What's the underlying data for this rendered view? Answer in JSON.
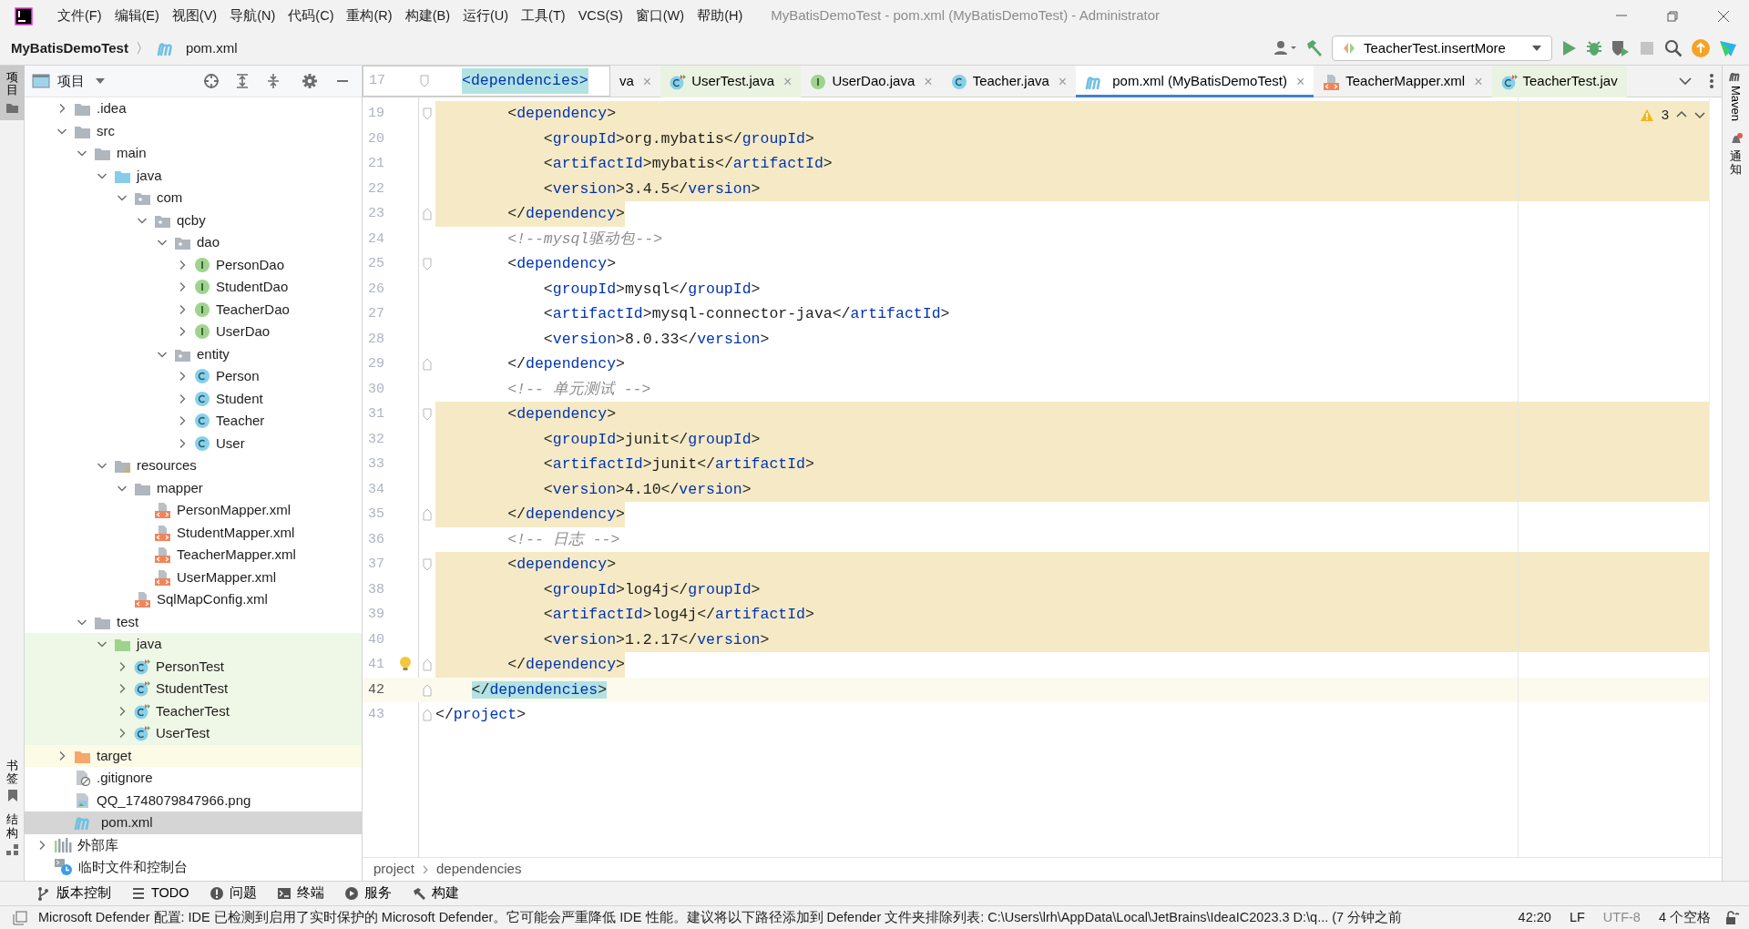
{
  "window": {
    "title": "MyBatisDemoTest - pom.xml (MyBatisDemoTest) - Administrator"
  },
  "menu": [
    "文件(F)",
    "编辑(E)",
    "视图(V)",
    "导航(N)",
    "代码(C)",
    "重构(R)",
    "构建(B)",
    "运行(U)",
    "工具(T)",
    "VCS(S)",
    "窗口(W)",
    "帮助(H)"
  ],
  "breadcrumb": {
    "project": "MyBatisDemoTest",
    "separator": "〉",
    "file": "pom.xml"
  },
  "run_config": {
    "label": "TeacherTest.insertMore"
  },
  "left_stripe": [
    {
      "label": "项目",
      "selected": true
    },
    {
      "label": "书签",
      "selected": false
    },
    {
      "label": "结构",
      "selected": false
    }
  ],
  "right_stripe": [
    {
      "kind": "maven",
      "label": "Maven"
    },
    {
      "kind": "notifications",
      "label": "通知"
    }
  ],
  "project_panel": {
    "title": "项目"
  },
  "tree": {
    "module_items": [
      {
        "label": ".idea",
        "kind": "folder",
        "expanded": false
      },
      {
        "label": "src",
        "kind": "folder",
        "expanded": true,
        "children": [
          {
            "label": "main",
            "kind": "folder",
            "expanded": true,
            "children": [
              {
                "label": "java",
                "kind": "source",
                "expanded": true,
                "children": [
                  {
                    "label": "com",
                    "kind": "package",
                    "expanded": true,
                    "children": [
                      {
                        "label": "qcby",
                        "kind": "package",
                        "expanded": true,
                        "children": [
                          {
                            "label": "dao",
                            "kind": "package",
                            "expanded": true,
                            "children": [
                              {
                                "label": "PersonDao",
                                "kind": "interface",
                                "expanded": false
                              },
                              {
                                "label": "StudentDao",
                                "kind": "interface",
                                "expanded": false
                              },
                              {
                                "label": "TeacherDao",
                                "kind": "interface",
                                "expanded": false
                              },
                              {
                                "label": "UserDao",
                                "kind": "interface",
                                "expanded": false
                              }
                            ]
                          },
                          {
                            "label": "entity",
                            "kind": "package",
                            "expanded": true,
                            "children": [
                              {
                                "label": "Person",
                                "kind": "class",
                                "expanded": false
                              },
                              {
                                "label": "Student",
                                "kind": "class",
                                "expanded": false
                              },
                              {
                                "label": "Teacher",
                                "kind": "class",
                                "expanded": false
                              },
                              {
                                "label": "User",
                                "kind": "class",
                                "expanded": false
                              }
                            ]
                          }
                        ]
                      }
                    ]
                  }
                ]
              },
              {
                "label": "resources",
                "kind": "resources",
                "expanded": true,
                "children": [
                  {
                    "label": "mapper",
                    "kind": "folder",
                    "expanded": true,
                    "children": [
                      {
                        "label": "PersonMapper.xml",
                        "kind": "xml"
                      },
                      {
                        "label": "StudentMapper.xml",
                        "kind": "xml"
                      },
                      {
                        "label": "TeacherMapper.xml",
                        "kind": "xml"
                      },
                      {
                        "label": "UserMapper.xml",
                        "kind": "xml"
                      }
                    ]
                  },
                  {
                    "label": "SqlMapConfig.xml",
                    "kind": "xml"
                  }
                ]
              }
            ]
          },
          {
            "label": "test",
            "kind": "folder",
            "expanded": true,
            "children": [
              {
                "label": "java",
                "kind": "test-source",
                "expanded": true,
                "children": [
                  {
                    "label": "PersonTest",
                    "kind": "test-class",
                    "expanded": false
                  },
                  {
                    "label": "StudentTest",
                    "kind": "test-class",
                    "expanded": false
                  },
                  {
                    "label": "TeacherTest",
                    "kind": "test-class",
                    "expanded": false
                  },
                  {
                    "label": "UserTest",
                    "kind": "test-class",
                    "expanded": false
                  }
                ]
              }
            ]
          }
        ]
      },
      {
        "label": "target",
        "kind": "excluded",
        "expanded": false
      },
      {
        "label": ".gitignore",
        "kind": "ignore"
      },
      {
        "label": "QQ_1748079847966.png",
        "kind": "image"
      },
      {
        "label": "pom.xml",
        "kind": "maven",
        "selected": true
      }
    ],
    "top_items": [
      {
        "label": "外部库",
        "kind": "library",
        "expanded": false
      },
      {
        "label": "临时文件和控制台",
        "kind": "scratch"
      }
    ]
  },
  "sticky": {
    "number": "17",
    "text": "<dependencies>"
  },
  "tabs": [
    {
      "label": "va",
      "kind": "none",
      "selected": false,
      "close": "×"
    },
    {
      "label": "UserTest.java",
      "kind": "test-class",
      "selected": false,
      "close": "×"
    },
    {
      "label": "UserDao.java",
      "kind": "interface",
      "selected": false,
      "close": "×"
    },
    {
      "label": "Teacher.java",
      "kind": "class",
      "selected": false,
      "close": "×"
    },
    {
      "label": "pom.xml (MyBatisDemoTest)",
      "kind": "maven",
      "selected": true,
      "close": "×"
    },
    {
      "label": "TeacherMapper.xml",
      "kind": "xml",
      "selected": false,
      "close": "×"
    },
    {
      "label": "TeacherTest.jav",
      "kind": "test-class",
      "selected": false
    }
  ],
  "warnings": {
    "count": "3"
  },
  "code": [
    {
      "num": "19",
      "kind": "highlighted",
      "fold_start": true,
      "parts": [
        {
          "kind": "plain",
          "text": "        <"
        },
        {
          "kind": "tag",
          "text": "dependency"
        },
        {
          "kind": "plain",
          "text": ">"
        }
      ]
    },
    {
      "num": "20",
      "kind": "highlighted",
      "parts": [
        {
          "kind": "plain",
          "text": "            <"
        },
        {
          "kind": "tag",
          "text": "groupId"
        },
        {
          "kind": "plain",
          "text": ">org.mybatis</"
        },
        {
          "kind": "tag",
          "text": "groupId"
        },
        {
          "kind": "plain",
          "text": ">"
        }
      ]
    },
    {
      "num": "21",
      "kind": "highlighted",
      "parts": [
        {
          "kind": "plain",
          "text": "            <"
        },
        {
          "kind": "tag",
          "text": "artifactId"
        },
        {
          "kind": "plain",
          "text": ">mybatis</"
        },
        {
          "kind": "tag",
          "text": "artifactId"
        },
        {
          "kind": "plain",
          "text": ">"
        }
      ]
    },
    {
      "num": "22",
      "kind": "highlighted",
      "parts": [
        {
          "kind": "plain",
          "text": "            <"
        },
        {
          "kind": "tag",
          "text": "version"
        },
        {
          "kind": "plain",
          "text": ">3.4.5</"
        },
        {
          "kind": "tag",
          "text": "version"
        },
        {
          "kind": "plain",
          "text": ">"
        }
      ]
    },
    {
      "num": "23",
      "kind": "highlighted-end",
      "fold_end": true,
      "parts": [
        {
          "kind": "plain",
          "text": "        </"
        },
        {
          "kind": "tag",
          "text": "dependency"
        },
        {
          "kind": "plain",
          "text": ">"
        }
      ]
    },
    {
      "num": "24",
      "kind": "normal",
      "parts": [
        {
          "kind": "comment",
          "text": "        <!--mysql驱动包-->"
        }
      ]
    },
    {
      "num": "25",
      "kind": "normal",
      "fold_start": true,
      "parts": [
        {
          "kind": "plain",
          "text": "        <"
        },
        {
          "kind": "tag",
          "text": "dependency"
        },
        {
          "kind": "plain",
          "text": ">"
        }
      ]
    },
    {
      "num": "26",
      "kind": "normal",
      "parts": [
        {
          "kind": "plain",
          "text": "            <"
        },
        {
          "kind": "tag",
          "text": "groupId"
        },
        {
          "kind": "plain",
          "text": ">mysql</"
        },
        {
          "kind": "tag",
          "text": "groupId"
        },
        {
          "kind": "plain",
          "text": ">"
        }
      ]
    },
    {
      "num": "27",
      "kind": "normal",
      "parts": [
        {
          "kind": "plain",
          "text": "            <"
        },
        {
          "kind": "tag",
          "text": "artifactId"
        },
        {
          "kind": "plain",
          "text": ">mysql-connector-java</"
        },
        {
          "kind": "tag",
          "text": "artifactId"
        },
        {
          "kind": "plain",
          "text": ">"
        }
      ]
    },
    {
      "num": "28",
      "kind": "normal",
      "parts": [
        {
          "kind": "plain",
          "text": "            <"
        },
        {
          "kind": "tag",
          "text": "version"
        },
        {
          "kind": "plain",
          "text": ">8.0.33</"
        },
        {
          "kind": "tag",
          "text": "version"
        },
        {
          "kind": "plain",
          "text": ">"
        }
      ]
    },
    {
      "num": "29",
      "kind": "normal",
      "fold_end": true,
      "parts": [
        {
          "kind": "plain",
          "text": "        </"
        },
        {
          "kind": "tag",
          "text": "dependency"
        },
        {
          "kind": "plain",
          "text": ">"
        }
      ]
    },
    {
      "num": "30",
      "kind": "normal",
      "parts": [
        {
          "kind": "comment",
          "text": "        <!-- 单元测试 -->"
        }
      ]
    },
    {
      "num": "31",
      "kind": "highlighted",
      "fold_start": true,
      "parts": [
        {
          "kind": "plain",
          "text": "        <"
        },
        {
          "kind": "tag",
          "text": "dependency"
        },
        {
          "kind": "plain",
          "text": ">"
        }
      ]
    },
    {
      "num": "32",
      "kind": "highlighted",
      "parts": [
        {
          "kind": "plain",
          "text": "            <"
        },
        {
          "kind": "tag",
          "text": "groupId"
        },
        {
          "kind": "plain",
          "text": ">junit</"
        },
        {
          "kind": "tag",
          "text": "groupId"
        },
        {
          "kind": "plain",
          "text": ">"
        }
      ]
    },
    {
      "num": "33",
      "kind": "highlighted",
      "parts": [
        {
          "kind": "plain",
          "text": "            <"
        },
        {
          "kind": "tag",
          "text": "artifactId"
        },
        {
          "kind": "plain",
          "text": ">junit</"
        },
        {
          "kind": "tag",
          "text": "artifactId"
        },
        {
          "kind": "plain",
          "text": ">"
        }
      ]
    },
    {
      "num": "34",
      "kind": "highlighted",
      "parts": [
        {
          "kind": "plain",
          "text": "            <"
        },
        {
          "kind": "tag",
          "text": "version"
        },
        {
          "kind": "plain",
          "text": ">4.10</"
        },
        {
          "kind": "tag",
          "text": "version"
        },
        {
          "kind": "plain",
          "text": ">"
        }
      ]
    },
    {
      "num": "35",
      "kind": "highlighted-end",
      "fold_end": true,
      "parts": [
        {
          "kind": "plain",
          "text": "        </"
        },
        {
          "kind": "tag",
          "text": "dependency"
        },
        {
          "kind": "plain",
          "text": ">"
        }
      ]
    },
    {
      "num": "36",
      "kind": "normal",
      "parts": [
        {
          "kind": "comment",
          "text": "        <!-- 日志 -->"
        }
      ]
    },
    {
      "num": "37",
      "kind": "highlighted",
      "fold_start": true,
      "parts": [
        {
          "kind": "plain",
          "text": "        <"
        },
        {
          "kind": "tag",
          "text": "dependency"
        },
        {
          "kind": "plain",
          "text": ">"
        }
      ]
    },
    {
      "num": "38",
      "kind": "highlighted",
      "parts": [
        {
          "kind": "plain",
          "text": "            <"
        },
        {
          "kind": "tag",
          "text": "groupId"
        },
        {
          "kind": "plain",
          "text": ">log4j</"
        },
        {
          "kind": "tag",
          "text": "groupId"
        },
        {
          "kind": "plain",
          "text": ">"
        }
      ]
    },
    {
      "num": "39",
      "kind": "highlighted",
      "parts": [
        {
          "kind": "plain",
          "text": "            <"
        },
        {
          "kind": "tag",
          "text": "artifactId"
        },
        {
          "kind": "plain",
          "text": ">log4j</"
        },
        {
          "kind": "tag",
          "text": "artifactId"
        },
        {
          "kind": "plain",
          "text": ">"
        }
      ]
    },
    {
      "num": "40",
      "kind": "highlighted",
      "parts": [
        {
          "kind": "plain",
          "text": "            <"
        },
        {
          "kind": "tag",
          "text": "version"
        },
        {
          "kind": "plain",
          "text": ">1.2.17</"
        },
        {
          "kind": "tag",
          "text": "version"
        },
        {
          "kind": "plain",
          "text": ">"
        }
      ]
    },
    {
      "num": "41",
      "kind": "highlighted-end",
      "fold_end": true,
      "bulb": true,
      "parts": [
        {
          "kind": "plain",
          "text": "        </"
        },
        {
          "kind": "tag",
          "text": "dependency"
        },
        {
          "kind": "plain",
          "text": ">"
        }
      ]
    },
    {
      "num": "42",
      "kind": "current",
      "fold_end": true,
      "parts": [
        {
          "kind": "match",
          "text": "    </"
        },
        {
          "kind": "match-tag",
          "text": "dependencies"
        },
        {
          "kind": "match",
          "text": ">"
        }
      ]
    },
    {
      "num": "43",
      "kind": "normal",
      "fold_end": true,
      "parts": [
        {
          "kind": "plain",
          "text": "</"
        },
        {
          "kind": "tag",
          "text": "project"
        },
        {
          "kind": "plain",
          "text": ">"
        }
      ]
    }
  ],
  "editor_breadcrumb": [
    "project",
    "dependencies"
  ],
  "tool_windows": [
    {
      "kind": "vcs",
      "label": "版本控制"
    },
    {
      "kind": "todo",
      "label": "TODO"
    },
    {
      "kind": "problems",
      "label": "问题"
    },
    {
      "kind": "terminal",
      "label": "终端"
    },
    {
      "kind": "services",
      "label": "服务"
    },
    {
      "kind": "build",
      "label": "构建"
    }
  ],
  "status_bar": {
    "message": "Microsoft Defender 配置: IDE 已检测到启用了实时保护的 Microsoft Defender。它可能会严重降低 IDE 性能。建议将以下路径添加到 Defender 文件夹排除列表: C:\\Users\\lrh\\AppData\\Local\\JetBrains\\IdeaIC2023.3 D:\\q... (7 分钟之前",
    "position": "42:20",
    "line_sep": "LF",
    "encoding": "UTF-8",
    "indent": "4 个空格"
  }
}
